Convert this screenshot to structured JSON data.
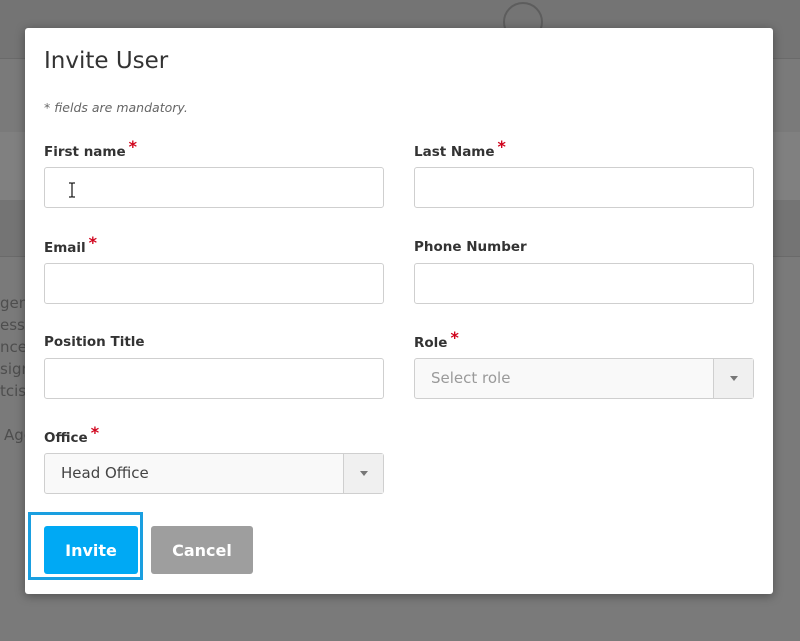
{
  "background": {
    "fragments": [
      "gent",
      "ess",
      "nce,",
      "sign",
      "tcis",
      "Age"
    ]
  },
  "modal": {
    "title": "Invite User",
    "mandatory_note": "* fields are mandatory.",
    "required_marker": "*",
    "fields": {
      "first_name": {
        "label": "First name",
        "value": "",
        "required": true
      },
      "last_name": {
        "label": "Last Name",
        "value": "",
        "required": true
      },
      "email": {
        "label": "Email",
        "value": "",
        "required": true
      },
      "phone": {
        "label": "Phone Number",
        "value": "",
        "required": false
      },
      "position": {
        "label": "Position Title",
        "value": "",
        "required": false
      },
      "role": {
        "label": "Role",
        "placeholder": "Select role",
        "required": true
      },
      "office": {
        "label": "Office",
        "value": "Head Office",
        "required": true
      }
    },
    "buttons": {
      "invite": "Invite",
      "cancel": "Cancel"
    },
    "colors": {
      "primary": "#00a9f4",
      "secondary": "#9e9e9e",
      "required": "#d0021b",
      "focus_highlight": "#1a9fe0"
    },
    "icons": {
      "text_cursor": "text-cursor-icon",
      "dropdown": "chevron-down-icon"
    }
  }
}
